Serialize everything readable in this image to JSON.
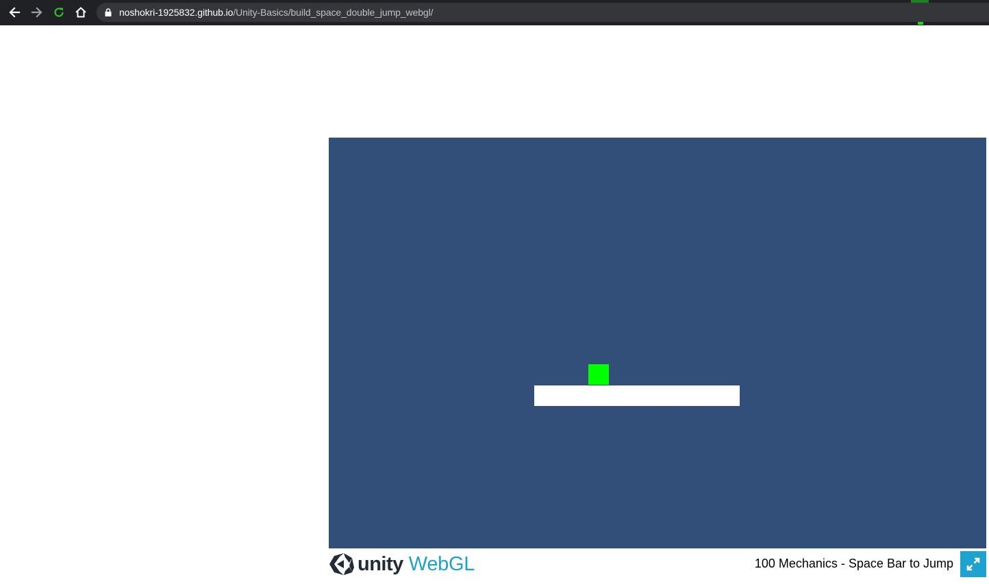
{
  "browser": {
    "url_host": "noshokri-1925832.github.io",
    "url_path": "/Unity-Basics/build_space_double_jump_webgl/",
    "icons": {
      "back": "arrow-left-icon",
      "forward": "arrow-right-icon",
      "reload": "reload-icon",
      "home": "home-icon",
      "lock": "lock-icon"
    }
  },
  "game": {
    "background_color": "#314f79",
    "player_color": "#00ff00",
    "platform_color": "#ffffff"
  },
  "footer": {
    "logo_unity": "unity",
    "logo_webgl": "WebGL",
    "title": "100 Mechanics - Space Bar to Jump",
    "fullscreen_icon": "fullscreen-icon",
    "accent_color": "#1ea3d0"
  }
}
